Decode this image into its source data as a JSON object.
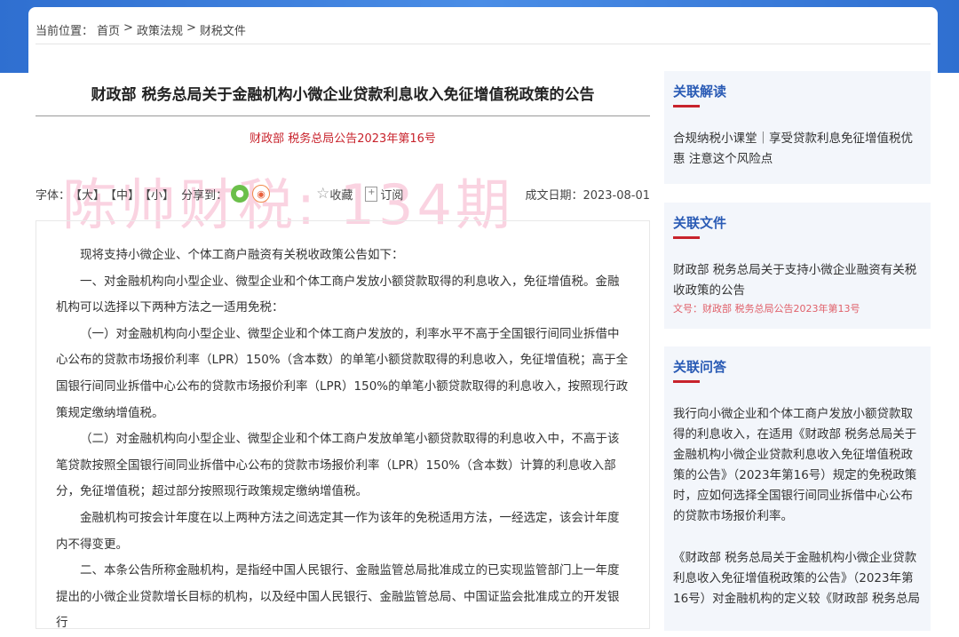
{
  "breadcrumb": {
    "label": "当前位置：",
    "items": [
      "首页",
      ">",
      "政策法规",
      ">",
      "财税文件"
    ]
  },
  "article": {
    "title": "财政部 税务总局关于金融机构小微企业贷款利息收入免征增值税政策的公告",
    "doc_no": "财政部 税务总局公告2023年第16号",
    "watermark": "陈帅财税: 134期",
    "toolbar": {
      "font_label": "字体：",
      "large": "【大】",
      "medium": "【中】",
      "small": "【小】",
      "share_label": "分享到：",
      "favorite": "收藏",
      "subscribe": "订阅",
      "date": "成文日期：2023-08-01"
    },
    "paragraphs": [
      "现将支持小微企业、个体工商户融资有关税收政策公告如下：",
      "一、对金融机构向小型企业、微型企业和个体工商户发放小额贷款取得的利息收入，免征增值税。金融机构可以选择以下两种方法之一适用免税：",
      "（一）对金融机构向小型企业、微型企业和个体工商户发放的，利率水平不高于全国银行间同业拆借中心公布的贷款市场报价利率（LPR）150%（含本数）的单笔小额贷款取得的利息收入，免征增值税；高于全国银行间同业拆借中心公布的贷款市场报价利率（LPR）150%的单笔小额贷款取得的利息收入，按照现行政策规定缴纳增值税。",
      "（二）对金融机构向小型企业、微型企业和个体工商户发放单笔小额贷款取得的利息收入中，不高于该笔贷款按照全国银行间同业拆借中心公布的贷款市场报价利率（LPR）150%（含本数）计算的利息收入部分，免征增值税；超过部分按照现行政策规定缴纳增值税。",
      "金融机构可按会计年度在以上两种方法之间选定其一作为该年的免税适用方法，一经选定，该会计年度内不得变更。",
      "二、本条公告所称金融机构，是指经中国人民银行、金融监管总局批准成立的已实现监管部门上一年度提出的小微企业贷款增长目标的机构，以及经中国人民银行、金融监管总局、中国证监会批准成立的开发银行"
    ]
  },
  "sidebar": [
    {
      "title": "关联解读",
      "items": [
        {
          "text": "合规纳税小课堂｜享受贷款利息免征增值税优惠 注意这个风险点"
        }
      ]
    },
    {
      "title": "关联文件",
      "items": [
        {
          "text": "财政部 税务总局关于支持小微企业融资有关税收政策的公告",
          "no": "文号：财政部 税务总局公告2023年第13号"
        }
      ]
    },
    {
      "title": "关联问答",
      "items": [
        {
          "text": "我行向小微企业和个体工商户发放小额贷款取得的利息收入，在适用《财政部 税务总局关于金融机构小微企业贷款利息收入免征增值税政策的公告》（2023年第16号）规定的免税政策时，应如何选择全国银行间同业拆借中心公布的贷款市场报价利率。"
        },
        {
          "text": "《财政部 税务总局关于金融机构小微企业贷款利息收入免征增值税政策的公告》（2023年第16号）对金融机构的定义较《财政部 税务总局"
        }
      ]
    }
  ]
}
